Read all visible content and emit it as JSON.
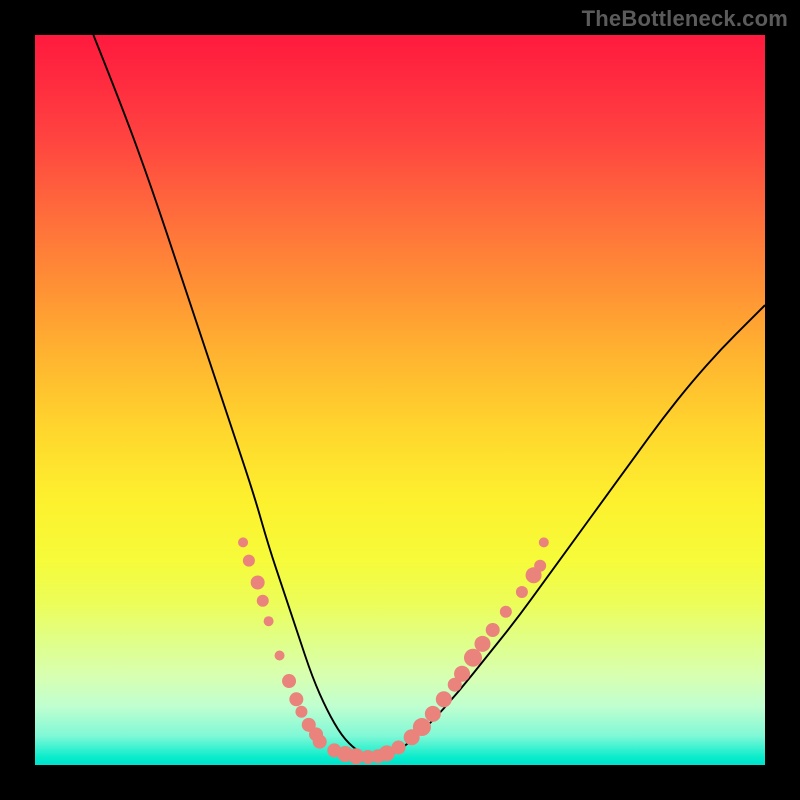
{
  "watermark": "TheBottleneck.com",
  "chart_data": {
    "type": "line",
    "title": "",
    "xlabel": "",
    "ylabel": "",
    "xlim": [
      0,
      100
    ],
    "ylim": [
      0,
      100
    ],
    "grid": false,
    "legend": false,
    "background": "gradient-heatmap",
    "series": [
      {
        "name": "curve",
        "stroke": "#000000",
        "x": [
          8,
          12,
          16,
          20,
          24,
          27,
          30,
          32,
          34,
          36,
          38,
          40,
          42,
          44,
          46,
          48,
          50,
          54,
          58,
          62,
          66,
          70,
          74,
          78,
          82,
          86,
          90,
          94,
          98,
          100
        ],
        "y": [
          100,
          90,
          79,
          67,
          55,
          46,
          37,
          30,
          24,
          18,
          12,
          7.5,
          4,
          2,
          1,
          1.2,
          2,
          5.5,
          10,
          15,
          20,
          25.5,
          31,
          36.5,
          42,
          47.5,
          52.5,
          57,
          61,
          63
        ]
      }
    ],
    "annotations": {
      "dots": {
        "color": "#e9837b",
        "radius_range": [
          5,
          10
        ],
        "points": [
          {
            "x": 28.5,
            "y": 30.5,
            "r": 5
          },
          {
            "x": 29.3,
            "y": 28.0,
            "r": 6
          },
          {
            "x": 30.5,
            "y": 25.0,
            "r": 7
          },
          {
            "x": 31.2,
            "y": 22.5,
            "r": 6
          },
          {
            "x": 32.0,
            "y": 19.7,
            "r": 5
          },
          {
            "x": 33.5,
            "y": 15.0,
            "r": 5
          },
          {
            "x": 34.8,
            "y": 11.5,
            "r": 7
          },
          {
            "x": 35.8,
            "y": 9.0,
            "r": 7
          },
          {
            "x": 36.5,
            "y": 7.3,
            "r": 6
          },
          {
            "x": 37.5,
            "y": 5.5,
            "r": 7
          },
          {
            "x": 38.5,
            "y": 4.2,
            "r": 7
          },
          {
            "x": 39.0,
            "y": 3.2,
            "r": 7
          },
          {
            "x": 41.0,
            "y": 2.0,
            "r": 7
          },
          {
            "x": 42.5,
            "y": 1.5,
            "r": 8
          },
          {
            "x": 44.0,
            "y": 1.2,
            "r": 8
          },
          {
            "x": 45.6,
            "y": 1.1,
            "r": 7
          },
          {
            "x": 47.0,
            "y": 1.2,
            "r": 7
          },
          {
            "x": 48.2,
            "y": 1.6,
            "r": 8
          },
          {
            "x": 49.8,
            "y": 2.4,
            "r": 7
          },
          {
            "x": 51.6,
            "y": 3.8,
            "r": 8
          },
          {
            "x": 53.0,
            "y": 5.2,
            "r": 9
          },
          {
            "x": 54.5,
            "y": 7.0,
            "r": 8
          },
          {
            "x": 56.0,
            "y": 9.0,
            "r": 8
          },
          {
            "x": 57.5,
            "y": 11.0,
            "r": 7
          },
          {
            "x": 58.5,
            "y": 12.5,
            "r": 8
          },
          {
            "x": 60.0,
            "y": 14.7,
            "r": 9
          },
          {
            "x": 61.3,
            "y": 16.6,
            "r": 8
          },
          {
            "x": 62.7,
            "y": 18.5,
            "r": 7
          },
          {
            "x": 64.5,
            "y": 21.0,
            "r": 6
          },
          {
            "x": 66.7,
            "y": 23.7,
            "r": 6
          },
          {
            "x": 68.3,
            "y": 26.0,
            "r": 8
          },
          {
            "x": 69.2,
            "y": 27.3,
            "r": 6
          },
          {
            "x": 69.7,
            "y": 30.5,
            "r": 5
          }
        ]
      }
    }
  }
}
